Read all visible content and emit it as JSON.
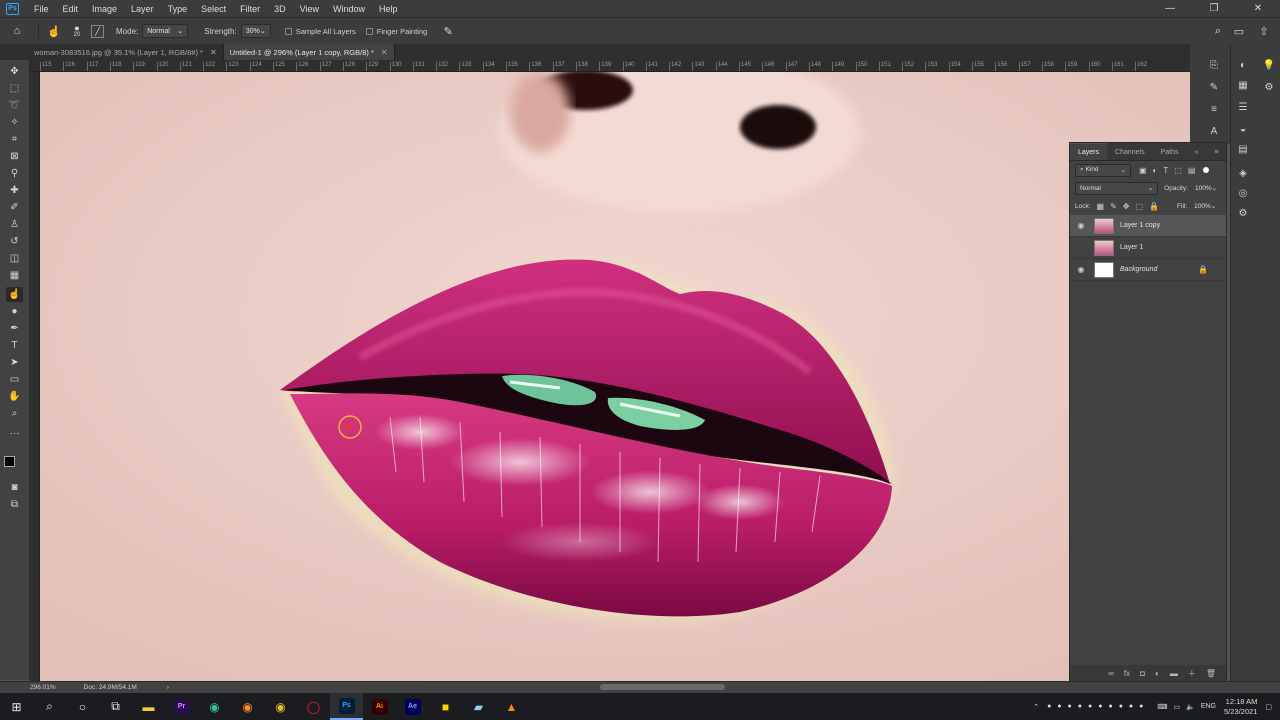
{
  "menubar": {
    "logo": "Ps",
    "items": [
      "File",
      "Edit",
      "Image",
      "Layer",
      "Type",
      "Select",
      "Filter",
      "3D",
      "View",
      "Window",
      "Help"
    ]
  },
  "options": {
    "brush_size": "20",
    "mode_label": "Mode:",
    "mode_value": "Normal",
    "strength_label": "Strength:",
    "strength_value": "30%",
    "sample_all_layers": "Sample All Layers",
    "finger_painting": "Finger Painting"
  },
  "tabs": [
    {
      "label": "woman-3083516.jpg @ 35.1% (Layer 1, RGB/8#) *"
    },
    {
      "label": "Untitled-1 @ 296% (Layer 1 copy, RGB/8) *"
    }
  ],
  "ruler": [
    "115",
    "116",
    "117",
    "118",
    "119",
    "120",
    "121",
    "122",
    "123",
    "124",
    "125",
    "126",
    "127",
    "128",
    "129",
    "130",
    "131",
    "132",
    "133",
    "134",
    "135",
    "136",
    "137",
    "138",
    "139",
    "140",
    "141",
    "142",
    "143",
    "144",
    "145",
    "146",
    "147",
    "148",
    "149",
    "150",
    "151",
    "152",
    "153",
    "154",
    "155",
    "156",
    "157",
    "158",
    "159",
    "160",
    "161",
    "162"
  ],
  "layers_panel": {
    "tabs": [
      "Layers",
      "Channels",
      "Paths"
    ],
    "kind": "Kind",
    "blend_mode": "Normal",
    "opacity_label": "Opacity:",
    "opacity_value": "100%",
    "lock_label": "Lock:",
    "fill_label": "Fill:",
    "fill_value": "100%",
    "layers": [
      {
        "name": "Layer 1 copy",
        "visible": true,
        "selected": true
      },
      {
        "name": "Layer 1",
        "visible": false,
        "selected": false
      },
      {
        "name": "Background",
        "visible": true,
        "selected": false
      }
    ]
  },
  "status": {
    "zoom": "296.01%",
    "doc": "Doc: 24.9M/54.1M"
  },
  "taskbar": {
    "apps": [
      {
        "name": "Pr",
        "color": "#2a0f4d",
        "fg": "#e77cff"
      },
      {
        "name": "Ps",
        "color": "#001e36",
        "fg": "#31a8ff"
      },
      {
        "name": "Ai",
        "color": "#330000",
        "fg": "#ff9a00"
      },
      {
        "name": "Ae",
        "color": "#00005b",
        "fg": "#9999ff"
      }
    ],
    "lang": "ENG",
    "time": "12:18 AM",
    "date": "5/23/2021"
  },
  "colors": {
    "accent": "#31a8ff",
    "lip": "#b01a64",
    "skin": "#eac9c3"
  }
}
